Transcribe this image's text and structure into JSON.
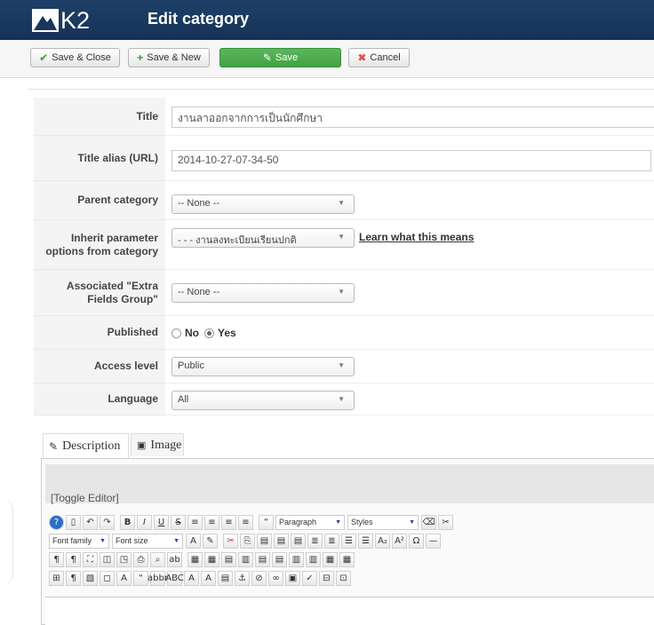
{
  "header": {
    "logo_text": "K2",
    "title": "Edit category"
  },
  "toolbar": {
    "save_close": "Save & Close",
    "save_new": "Save & New",
    "save": "Save",
    "cancel": "Cancel"
  },
  "form": {
    "title": {
      "label": "Title",
      "value": "งานลาออกจากการเป็นนักศึกษา"
    },
    "alias": {
      "label": "Title alias (URL)",
      "value": "2014-10-27-07-34-50"
    },
    "parent": {
      "label": "Parent category",
      "value": "-- None --"
    },
    "inherit": {
      "label_line1": "Inherit parameter",
      "label_line2": "options from category",
      "value": "- - - งานลงทะเบียนเรียนปกติ",
      "link": "Learn what this means"
    },
    "extra": {
      "label_line1": "Associated \"Extra",
      "label_line2": "Fields Group\"",
      "value": "-- None --"
    },
    "published": {
      "label": "Published",
      "no": "No",
      "yes": "Yes",
      "selected": "Yes"
    },
    "access": {
      "label": "Access level",
      "value": "Public"
    },
    "language": {
      "label": "Language",
      "value": "All"
    }
  },
  "tabs": [
    {
      "label": "Description"
    },
    {
      "label": "Image"
    }
  ],
  "editor": {
    "toggle": "[Toggle Editor]",
    "paragraph": "Paragraph",
    "styles": "Styles",
    "font_family": "Font family",
    "font_size": "Font size"
  },
  "colors": {
    "header_bg": "#18365c",
    "save_green": "#4cae4c",
    "cancel_red": "#d9534f"
  }
}
